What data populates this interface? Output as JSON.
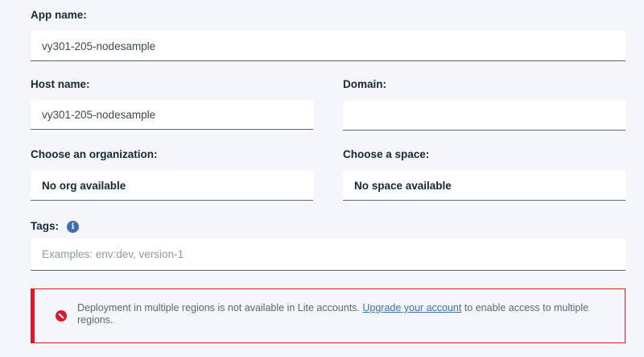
{
  "app_name": {
    "label": "App name:",
    "value": "vy301-205-nodesample"
  },
  "host_name": {
    "label": "Host name:",
    "value": "vy301-205-nodesample"
  },
  "domain": {
    "label": "Domain:",
    "value": ""
  },
  "organization": {
    "label": "Choose an organization:",
    "value": "No org available"
  },
  "space": {
    "label": "Choose a space:",
    "value": "No space available"
  },
  "tags": {
    "label": "Tags:",
    "info_icon": "i",
    "placeholder": "Examples: env:dev, version-1"
  },
  "notification": {
    "icon": "error-icon",
    "text_before": "Deployment in multiple regions is not available in Lite accounts. ",
    "link_text": "Upgrade your account",
    "text_after": " to enable access to multiple regions."
  },
  "colors": {
    "error": "#e0182d",
    "link": "#3d70b2",
    "info": "#3d70b2"
  }
}
